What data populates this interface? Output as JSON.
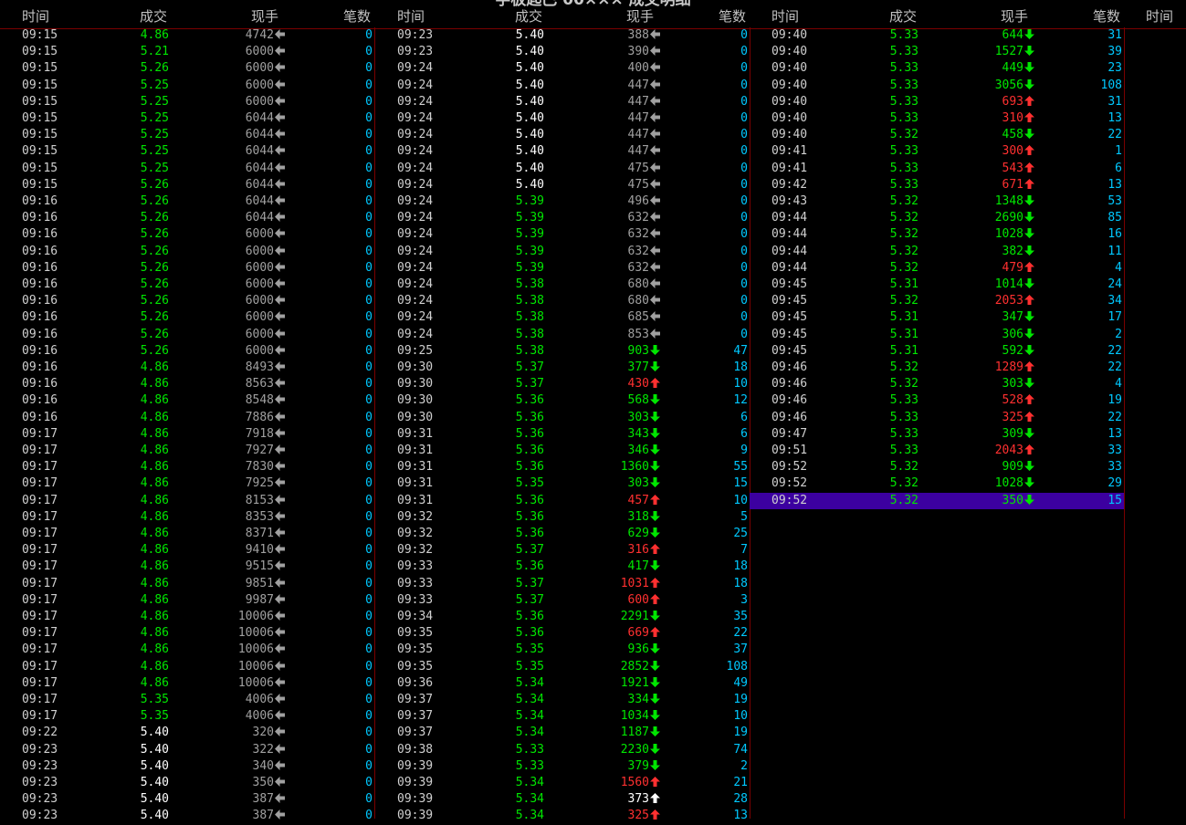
{
  "title": "字板匙巴 00××× 成交明细",
  "headers": [
    "时间",
    "成交",
    "现手",
    "笔数"
  ],
  "extra_header": "时间",
  "colors": {
    "up": "#ff3030",
    "down": "#00e600",
    "flat": "#ffffff",
    "neutral": "#a0a0a0",
    "count": "#00c8ff",
    "selected": "#3c00a0",
    "grid": "#7a0000"
  },
  "columns": [
    [
      [
        "09:15",
        "4.86",
        "4742",
        "0",
        "g",
        "gray",
        "left"
      ],
      [
        "09:15",
        "5.21",
        "6000",
        "0",
        "g",
        "gray",
        "left"
      ],
      [
        "09:15",
        "5.26",
        "6000",
        "0",
        "g",
        "gray",
        "left"
      ],
      [
        "09:15",
        "5.25",
        "6000",
        "0",
        "g",
        "gray",
        "left"
      ],
      [
        "09:15",
        "5.25",
        "6000",
        "0",
        "g",
        "gray",
        "left"
      ],
      [
        "09:15",
        "5.25",
        "6044",
        "0",
        "g",
        "gray",
        "left"
      ],
      [
        "09:15",
        "5.25",
        "6044",
        "0",
        "g",
        "gray",
        "left"
      ],
      [
        "09:15",
        "5.25",
        "6044",
        "0",
        "g",
        "gray",
        "left"
      ],
      [
        "09:15",
        "5.25",
        "6044",
        "0",
        "g",
        "gray",
        "left"
      ],
      [
        "09:15",
        "5.26",
        "6044",
        "0",
        "g",
        "gray",
        "left"
      ],
      [
        "09:16",
        "5.26",
        "6044",
        "0",
        "g",
        "gray",
        "left"
      ],
      [
        "09:16",
        "5.26",
        "6044",
        "0",
        "g",
        "gray",
        "left"
      ],
      [
        "09:16",
        "5.26",
        "6000",
        "0",
        "g",
        "gray",
        "left"
      ],
      [
        "09:16",
        "5.26",
        "6000",
        "0",
        "g",
        "gray",
        "left"
      ],
      [
        "09:16",
        "5.26",
        "6000",
        "0",
        "g",
        "gray",
        "left"
      ],
      [
        "09:16",
        "5.26",
        "6000",
        "0",
        "g",
        "gray",
        "left"
      ],
      [
        "09:16",
        "5.26",
        "6000",
        "0",
        "g",
        "gray",
        "left"
      ],
      [
        "09:16",
        "5.26",
        "6000",
        "0",
        "g",
        "gray",
        "left"
      ],
      [
        "09:16",
        "5.26",
        "6000",
        "0",
        "g",
        "gray",
        "left"
      ],
      [
        "09:16",
        "5.26",
        "6000",
        "0",
        "g",
        "gray",
        "left"
      ],
      [
        "09:16",
        "4.86",
        "8493",
        "0",
        "g",
        "gray",
        "left"
      ],
      [
        "09:16",
        "4.86",
        "8563",
        "0",
        "g",
        "gray",
        "left"
      ],
      [
        "09:16",
        "4.86",
        "8548",
        "0",
        "g",
        "gray",
        "left"
      ],
      [
        "09:16",
        "4.86",
        "7886",
        "0",
        "g",
        "gray",
        "left"
      ],
      [
        "09:17",
        "4.86",
        "7918",
        "0",
        "g",
        "gray",
        "left"
      ],
      [
        "09:17",
        "4.86",
        "7927",
        "0",
        "g",
        "gray",
        "left"
      ],
      [
        "09:17",
        "4.86",
        "7830",
        "0",
        "g",
        "gray",
        "left"
      ],
      [
        "09:17",
        "4.86",
        "7925",
        "0",
        "g",
        "gray",
        "left"
      ],
      [
        "09:17",
        "4.86",
        "8153",
        "0",
        "g",
        "gray",
        "left"
      ],
      [
        "09:17",
        "4.86",
        "8353",
        "0",
        "g",
        "gray",
        "left"
      ],
      [
        "09:17",
        "4.86",
        "8371",
        "0",
        "g",
        "gray",
        "left"
      ],
      [
        "09:17",
        "4.86",
        "9410",
        "0",
        "g",
        "gray",
        "left"
      ],
      [
        "09:17",
        "4.86",
        "9515",
        "0",
        "g",
        "gray",
        "left"
      ],
      [
        "09:17",
        "4.86",
        "9851",
        "0",
        "g",
        "gray",
        "left"
      ],
      [
        "09:17",
        "4.86",
        "9987",
        "0",
        "g",
        "gray",
        "left"
      ],
      [
        "09:17",
        "4.86",
        "10006",
        "0",
        "g",
        "gray",
        "left"
      ],
      [
        "09:17",
        "4.86",
        "10006",
        "0",
        "g",
        "gray",
        "left"
      ],
      [
        "09:17",
        "4.86",
        "10006",
        "0",
        "g",
        "gray",
        "left"
      ],
      [
        "09:17",
        "4.86",
        "10006",
        "0",
        "g",
        "gray",
        "left"
      ],
      [
        "09:17",
        "4.86",
        "10006",
        "0",
        "g",
        "gray",
        "left"
      ],
      [
        "09:17",
        "5.35",
        "4006",
        "0",
        "g",
        "gray",
        "left"
      ],
      [
        "09:17",
        "5.35",
        "4006",
        "0",
        "g",
        "gray",
        "left"
      ],
      [
        "09:22",
        "5.40",
        "320",
        "0",
        "w",
        "gray",
        "left"
      ],
      [
        "09:23",
        "5.40",
        "322",
        "0",
        "w",
        "gray",
        "left"
      ],
      [
        "09:23",
        "5.40",
        "340",
        "0",
        "w",
        "gray",
        "left"
      ],
      [
        "09:23",
        "5.40",
        "350",
        "0",
        "w",
        "gray",
        "left"
      ],
      [
        "09:23",
        "5.40",
        "387",
        "0",
        "w",
        "gray",
        "left"
      ],
      [
        "09:23",
        "5.40",
        "387",
        "0",
        "w",
        "gray",
        "left"
      ]
    ],
    [
      [
        "09:23",
        "5.40",
        "388",
        "0",
        "w",
        "gray",
        "left"
      ],
      [
        "09:23",
        "5.40",
        "390",
        "0",
        "w",
        "gray",
        "left"
      ],
      [
        "09:24",
        "5.40",
        "400",
        "0",
        "w",
        "gray",
        "left"
      ],
      [
        "09:24",
        "5.40",
        "447",
        "0",
        "w",
        "gray",
        "left"
      ],
      [
        "09:24",
        "5.40",
        "447",
        "0",
        "w",
        "gray",
        "left"
      ],
      [
        "09:24",
        "5.40",
        "447",
        "0",
        "w",
        "gray",
        "left"
      ],
      [
        "09:24",
        "5.40",
        "447",
        "0",
        "w",
        "gray",
        "left"
      ],
      [
        "09:24",
        "5.40",
        "447",
        "0",
        "w",
        "gray",
        "left"
      ],
      [
        "09:24",
        "5.40",
        "475",
        "0",
        "w",
        "gray",
        "left"
      ],
      [
        "09:24",
        "5.40",
        "475",
        "0",
        "w",
        "gray",
        "left"
      ],
      [
        "09:24",
        "5.39",
        "496",
        "0",
        "g",
        "gray",
        "left"
      ],
      [
        "09:24",
        "5.39",
        "632",
        "0",
        "g",
        "gray",
        "left"
      ],
      [
        "09:24",
        "5.39",
        "632",
        "0",
        "g",
        "gray",
        "left"
      ],
      [
        "09:24",
        "5.39",
        "632",
        "0",
        "g",
        "gray",
        "left"
      ],
      [
        "09:24",
        "5.39",
        "632",
        "0",
        "g",
        "gray",
        "left"
      ],
      [
        "09:24",
        "5.38",
        "680",
        "0",
        "g",
        "gray",
        "left"
      ],
      [
        "09:24",
        "5.38",
        "680",
        "0",
        "g",
        "gray",
        "left"
      ],
      [
        "09:24",
        "5.38",
        "685",
        "0",
        "g",
        "gray",
        "left"
      ],
      [
        "09:24",
        "5.38",
        "853",
        "0",
        "g",
        "gray",
        "left"
      ],
      [
        "09:25",
        "5.38",
        "903",
        "47",
        "g",
        "g",
        "down"
      ],
      [
        "09:30",
        "5.37",
        "377",
        "18",
        "g",
        "g",
        "down"
      ],
      [
        "09:30",
        "5.37",
        "430",
        "10",
        "g",
        "r",
        "up"
      ],
      [
        "09:30",
        "5.36",
        "568",
        "12",
        "g",
        "g",
        "down"
      ],
      [
        "09:30",
        "5.36",
        "303",
        "6",
        "g",
        "g",
        "down"
      ],
      [
        "09:31",
        "5.36",
        "343",
        "6",
        "g",
        "g",
        "down"
      ],
      [
        "09:31",
        "5.36",
        "346",
        "9",
        "g",
        "g",
        "down"
      ],
      [
        "09:31",
        "5.36",
        "1360",
        "55",
        "g",
        "g",
        "down"
      ],
      [
        "09:31",
        "5.35",
        "303",
        "15",
        "g",
        "g",
        "down"
      ],
      [
        "09:31",
        "5.36",
        "457",
        "10",
        "g",
        "r",
        "up"
      ],
      [
        "09:32",
        "5.36",
        "318",
        "5",
        "g",
        "g",
        "down"
      ],
      [
        "09:32",
        "5.36",
        "629",
        "25",
        "g",
        "g",
        "down"
      ],
      [
        "09:32",
        "5.37",
        "316",
        "7",
        "g",
        "r",
        "up"
      ],
      [
        "09:33",
        "5.36",
        "417",
        "18",
        "g",
        "g",
        "down"
      ],
      [
        "09:33",
        "5.37",
        "1031",
        "18",
        "g",
        "r",
        "up"
      ],
      [
        "09:33",
        "5.37",
        "600",
        "3",
        "g",
        "r",
        "up"
      ],
      [
        "09:34",
        "5.36",
        "2291",
        "35",
        "g",
        "g",
        "down"
      ],
      [
        "09:35",
        "5.36",
        "669",
        "22",
        "g",
        "r",
        "up"
      ],
      [
        "09:35",
        "5.35",
        "936",
        "37",
        "g",
        "g",
        "down"
      ],
      [
        "09:35",
        "5.35",
        "2852",
        "108",
        "g",
        "g",
        "down"
      ],
      [
        "09:36",
        "5.34",
        "1921",
        "49",
        "g",
        "g",
        "down"
      ],
      [
        "09:37",
        "5.34",
        "334",
        "19",
        "g",
        "g",
        "down"
      ],
      [
        "09:37",
        "5.34",
        "1034",
        "10",
        "g",
        "g",
        "down"
      ],
      [
        "09:37",
        "5.34",
        "1187",
        "19",
        "g",
        "g",
        "down"
      ],
      [
        "09:38",
        "5.33",
        "2230",
        "74",
        "g",
        "g",
        "down"
      ],
      [
        "09:39",
        "5.33",
        "379",
        "2",
        "g",
        "g",
        "down"
      ],
      [
        "09:39",
        "5.34",
        "1560",
        "21",
        "g",
        "r",
        "up"
      ],
      [
        "09:39",
        "5.34",
        "373",
        "28",
        "g",
        "w",
        "up"
      ],
      [
        "09:39",
        "5.34",
        "325",
        "13",
        "g",
        "r",
        "up"
      ]
    ],
    [
      [
        "09:40",
        "5.33",
        "644",
        "31",
        "g",
        "g",
        "down"
      ],
      [
        "09:40",
        "5.33",
        "1527",
        "39",
        "g",
        "g",
        "down"
      ],
      [
        "09:40",
        "5.33",
        "449",
        "23",
        "g",
        "g",
        "down"
      ],
      [
        "09:40",
        "5.33",
        "3056",
        "108",
        "g",
        "g",
        "down"
      ],
      [
        "09:40",
        "5.33",
        "693",
        "31",
        "g",
        "r",
        "up"
      ],
      [
        "09:40",
        "5.33",
        "310",
        "13",
        "g",
        "r",
        "up"
      ],
      [
        "09:40",
        "5.32",
        "458",
        "22",
        "g",
        "g",
        "down"
      ],
      [
        "09:41",
        "5.33",
        "300",
        "1",
        "g",
        "r",
        "up"
      ],
      [
        "09:41",
        "5.33",
        "543",
        "6",
        "g",
        "r",
        "up"
      ],
      [
        "09:42",
        "5.33",
        "671",
        "13",
        "g",
        "r",
        "up"
      ],
      [
        "09:43",
        "5.32",
        "1348",
        "53",
        "g",
        "g",
        "down"
      ],
      [
        "09:44",
        "5.32",
        "2690",
        "85",
        "g",
        "g",
        "down"
      ],
      [
        "09:44",
        "5.32",
        "1028",
        "16",
        "g",
        "g",
        "down"
      ],
      [
        "09:44",
        "5.32",
        "382",
        "11",
        "g",
        "g",
        "down"
      ],
      [
        "09:44",
        "5.32",
        "479",
        "4",
        "g",
        "r",
        "up"
      ],
      [
        "09:45",
        "5.31",
        "1014",
        "24",
        "g",
        "g",
        "down"
      ],
      [
        "09:45",
        "5.32",
        "2053",
        "34",
        "g",
        "r",
        "up"
      ],
      [
        "09:45",
        "5.31",
        "347",
        "17",
        "g",
        "g",
        "down"
      ],
      [
        "09:45",
        "5.31",
        "306",
        "2",
        "g",
        "g",
        "down"
      ],
      [
        "09:45",
        "5.31",
        "592",
        "22",
        "g",
        "g",
        "down"
      ],
      [
        "09:46",
        "5.32",
        "1289",
        "22",
        "g",
        "r",
        "up"
      ],
      [
        "09:46",
        "5.32",
        "303",
        "4",
        "g",
        "g",
        "down"
      ],
      [
        "09:46",
        "5.33",
        "528",
        "19",
        "g",
        "r",
        "up"
      ],
      [
        "09:46",
        "5.33",
        "325",
        "22",
        "g",
        "r",
        "up"
      ],
      [
        "09:47",
        "5.33",
        "309",
        "13",
        "g",
        "g",
        "down"
      ],
      [
        "09:51",
        "5.33",
        "2043",
        "33",
        "g",
        "r",
        "up"
      ],
      [
        "09:52",
        "5.32",
        "909",
        "33",
        "g",
        "g",
        "down"
      ],
      [
        "09:52",
        "5.32",
        "1028",
        "29",
        "g",
        "g",
        "down"
      ],
      [
        "09:52",
        "5.32",
        "350",
        "15",
        "g",
        "g",
        "down"
      ]
    ]
  ],
  "selected": {
    "column": 2,
    "row": 28
  }
}
